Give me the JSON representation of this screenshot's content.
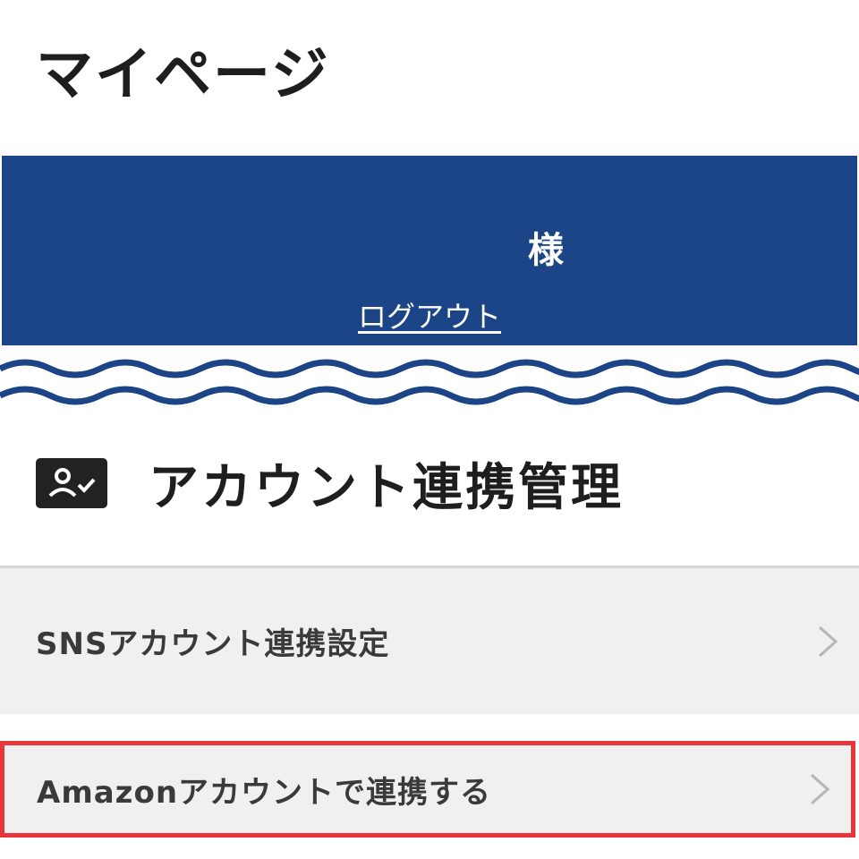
{
  "page": {
    "title": "マイページ"
  },
  "banner": {
    "name_suffix": "様",
    "logout_label": "ログアウト",
    "color": "#1c4587"
  },
  "section": {
    "title": "アカウント連携管理",
    "icon": "account-check-icon"
  },
  "menu": {
    "items": [
      {
        "label": "SNSアカウント連携設定",
        "icon": "chevron-right-icon"
      },
      {
        "label": "Amazonアカウントで連携する",
        "icon": "chevron-right-icon",
        "highlighted": true,
        "highlight_color": "#e8353a"
      }
    ]
  }
}
